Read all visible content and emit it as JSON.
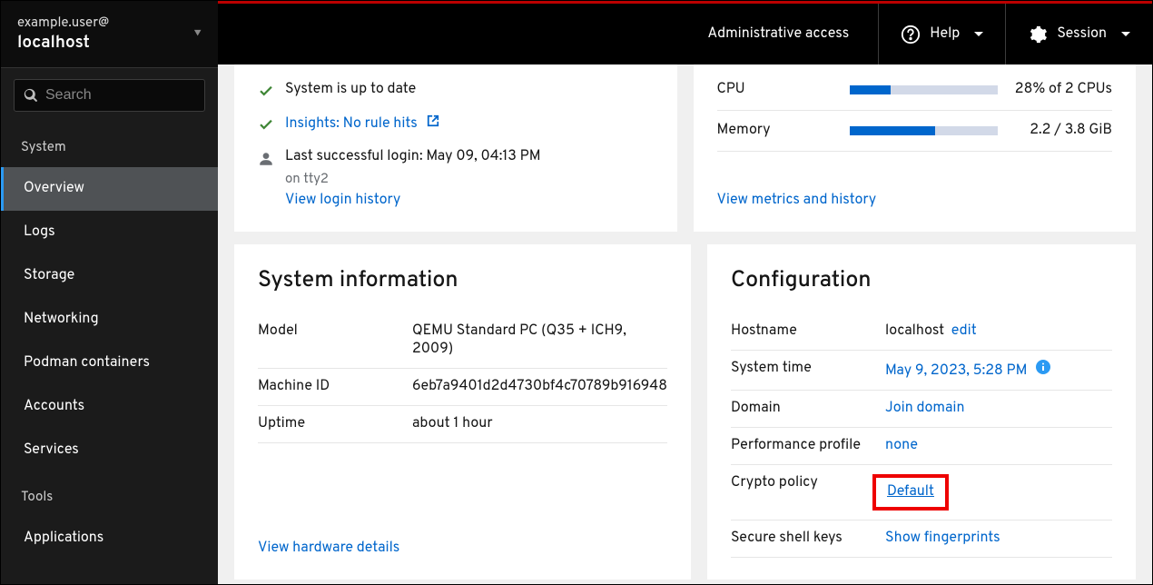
{
  "host": {
    "user": "example.user@",
    "name": "localhost"
  },
  "search": {
    "placeholder": "Search"
  },
  "nav": {
    "system_title": "System",
    "items": [
      "Overview",
      "Logs",
      "Storage",
      "Networking",
      "Podman containers",
      "Accounts",
      "Services"
    ],
    "tools_title": "Tools",
    "tools_items": [
      "Applications"
    ]
  },
  "topbar": {
    "admin": "Administrative access",
    "help": "Help",
    "session": "Session"
  },
  "health": {
    "uptodate": "System is up to date",
    "insights": "Insights: No rule hits",
    "last_login_label": "Last successful login: May 09, 04:13 PM",
    "last_login_sub": "on tty2",
    "view_login": "View login history"
  },
  "usage": {
    "cpu": {
      "label": "CPU",
      "text": "28% of 2 CPUs",
      "pct": 28
    },
    "mem": {
      "label": "Memory",
      "text": "2.2 / 3.8 GiB",
      "pct": 58
    },
    "link": "View metrics and history"
  },
  "sysinfo": {
    "title": "System information",
    "rows": [
      {
        "k": "Model",
        "v": "QEMU Standard PC (Q35 + ICH9, 2009)"
      },
      {
        "k": "Machine ID",
        "v": "6eb7a9401d2d4730bf4c70789b916948"
      },
      {
        "k": "Uptime",
        "v": "about 1 hour"
      }
    ],
    "link": "View hardware details"
  },
  "config": {
    "title": "Configuration",
    "hostname_k": "Hostname",
    "hostname_v": "localhost",
    "hostname_edit": "edit",
    "time_k": "System time",
    "time_v": "May 9, 2023, 5:28 PM",
    "domain_k": "Domain",
    "domain_v": "Join domain",
    "perf_k": "Performance profile",
    "perf_v": "none",
    "crypto_k": "Crypto policy",
    "crypto_v": "Default",
    "ssh_k": "Secure shell keys",
    "ssh_v": "Show fingerprints"
  }
}
